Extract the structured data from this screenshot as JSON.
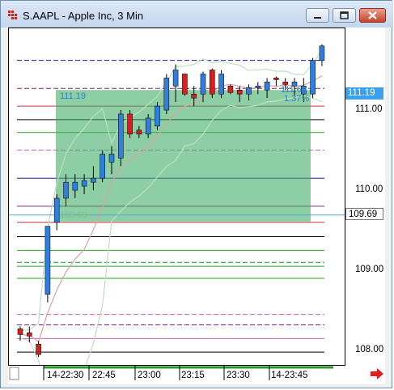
{
  "window": {
    "title": "S.AAPL - Apple Inc, 3 Min",
    "buttons": [
      "minimize",
      "maximize",
      "close"
    ]
  },
  "chart_data": {
    "type": "candlestick",
    "symbol": "S.AAPL",
    "interval": "3 Min",
    "x_tick_labels": [
      "14-22:30",
      "22:45",
      "23:00",
      "23:15",
      "23:30",
      "14-23:45"
    ],
    "y_tick_labels": [
      "108.00",
      "109.00",
      "110.00",
      "111.00"
    ],
    "ylim": [
      107.82,
      112.02
    ],
    "current_price": "111.19",
    "marker_price": "109.69",
    "box_top_label": "111.19",
    "box_bottom_label": "109.69",
    "box_mid_label": "111.69",
    "box_mid_label2": "1.37%",
    "candles": [
      {
        "o": 108.27,
        "h": 108.3,
        "l": 108.12,
        "c": 108.2
      },
      {
        "o": 108.22,
        "h": 108.3,
        "l": 108.1,
        "c": 108.18
      },
      {
        "o": 108.08,
        "h": 108.12,
        "l": 107.92,
        "c": 107.95
      },
      {
        "o": 108.7,
        "h": 109.55,
        "l": 108.6,
        "c": 109.55
      },
      {
        "o": 109.6,
        "h": 109.95,
        "l": 109.5,
        "c": 109.9
      },
      {
        "o": 109.9,
        "h": 110.2,
        "l": 109.8,
        "c": 110.1
      },
      {
        "o": 110.0,
        "h": 110.2,
        "l": 109.9,
        "c": 110.1
      },
      {
        "o": 110.05,
        "h": 110.2,
        "l": 109.95,
        "c": 110.12
      },
      {
        "o": 110.1,
        "h": 110.3,
        "l": 110.0,
        "c": 110.15
      },
      {
        "o": 110.15,
        "h": 110.5,
        "l": 110.1,
        "c": 110.45
      },
      {
        "o": 110.35,
        "h": 110.55,
        "l": 110.2,
        "c": 110.45
      },
      {
        "o": 110.4,
        "h": 111.0,
        "l": 110.3,
        "c": 110.95
      },
      {
        "o": 110.95,
        "h": 111.0,
        "l": 110.65,
        "c": 110.7
      },
      {
        "o": 110.75,
        "h": 110.8,
        "l": 110.65,
        "c": 110.7
      },
      {
        "o": 110.7,
        "h": 110.95,
        "l": 110.65,
        "c": 110.9
      },
      {
        "o": 110.8,
        "h": 111.1,
        "l": 110.75,
        "c": 111.05
      },
      {
        "o": 111.0,
        "h": 111.45,
        "l": 110.95,
        "c": 111.4
      },
      {
        "o": 111.3,
        "h": 111.57,
        "l": 111.1,
        "c": 111.5
      },
      {
        "o": 111.45,
        "h": 111.45,
        "l": 111.18,
        "c": 111.2
      },
      {
        "o": 111.2,
        "h": 111.3,
        "l": 111.05,
        "c": 111.15
      },
      {
        "o": 111.2,
        "h": 111.48,
        "l": 111.1,
        "c": 111.45
      },
      {
        "o": 111.5,
        "h": 111.52,
        "l": 111.15,
        "c": 111.2
      },
      {
        "o": 111.2,
        "h": 111.5,
        "l": 111.15,
        "c": 111.45
      },
      {
        "o": 111.3,
        "h": 111.32,
        "l": 111.2,
        "c": 111.22
      },
      {
        "o": 111.25,
        "h": 111.3,
        "l": 111.1,
        "c": 111.2
      },
      {
        "o": 111.2,
        "h": 111.32,
        "l": 111.12,
        "c": 111.28
      },
      {
        "o": 111.28,
        "h": 111.35,
        "l": 111.2,
        "c": 111.3
      },
      {
        "o": 111.25,
        "h": 111.4,
        "l": 111.15,
        "c": 111.35
      },
      {
        "o": 111.4,
        "h": 111.42,
        "l": 111.3,
        "c": 111.38
      },
      {
        "o": 111.35,
        "h": 111.4,
        "l": 111.25,
        "c": 111.32
      },
      {
        "o": 111.3,
        "h": 111.4,
        "l": 111.18,
        "c": 111.35
      },
      {
        "o": 111.2,
        "h": 111.4,
        "l": 111.1,
        "c": 111.3
      },
      {
        "o": 111.2,
        "h": 111.65,
        "l": 111.15,
        "c": 111.62
      },
      {
        "o": 111.62,
        "h": 111.82,
        "l": 111.55,
        "c": 111.8
      }
    ],
    "horizontal_levels": [
      {
        "price": 111.62,
        "color": "#1a1ab8",
        "style": "dash"
      },
      {
        "price": 111.27,
        "color": "#7a2a7a",
        "style": "dash"
      },
      {
        "price": 111.05,
        "color": "#c0303a",
        "style": "solid"
      },
      {
        "price": 110.88,
        "color": "#000000",
        "style": "solid"
      },
      {
        "price": 110.72,
        "color": "#22aa22",
        "style": "solid"
      },
      {
        "price": 110.5,
        "color": "#d060c0",
        "style": "dash"
      },
      {
        "price": 110.15,
        "color": "#1a1ab8",
        "style": "solid"
      },
      {
        "price": 109.8,
        "color": "#7a2a7a",
        "style": "solid"
      },
      {
        "price": 109.6,
        "color": "#c0303a",
        "style": "solid"
      },
      {
        "price": 109.42,
        "color": "#000000",
        "style": "solid"
      },
      {
        "price": 109.25,
        "color": "#22aa22",
        "style": "solid"
      },
      {
        "price": 109.1,
        "color": "#1e8a3a",
        "style": "dash"
      },
      {
        "price": 109.05,
        "color": "#22aa22",
        "style": "solid"
      },
      {
        "price": 108.9,
        "color": "#22aa22",
        "style": "solid"
      },
      {
        "price": 108.45,
        "color": "#d060c0",
        "style": "dash"
      },
      {
        "price": 108.32,
        "color": "#7a2a7a",
        "style": "dash"
      },
      {
        "price": 108.15,
        "color": "#d060c0",
        "style": "solid"
      },
      {
        "price": 107.98,
        "color": "#000000",
        "style": "solid"
      },
      {
        "price": 107.8,
        "color": "#c0303a",
        "style": "solid"
      }
    ],
    "colors": {
      "up": "#2f7fe0",
      "down": "#d62020",
      "box": "#3daa62",
      "bollinger": "#bfe0bf",
      "moving_average": "#e0a0a0",
      "current_tag": "#3aa0f0",
      "marker_line": "#4aa8d8"
    }
  },
  "navigation": {
    "scroll_right_icon": "red-arrow-right"
  }
}
